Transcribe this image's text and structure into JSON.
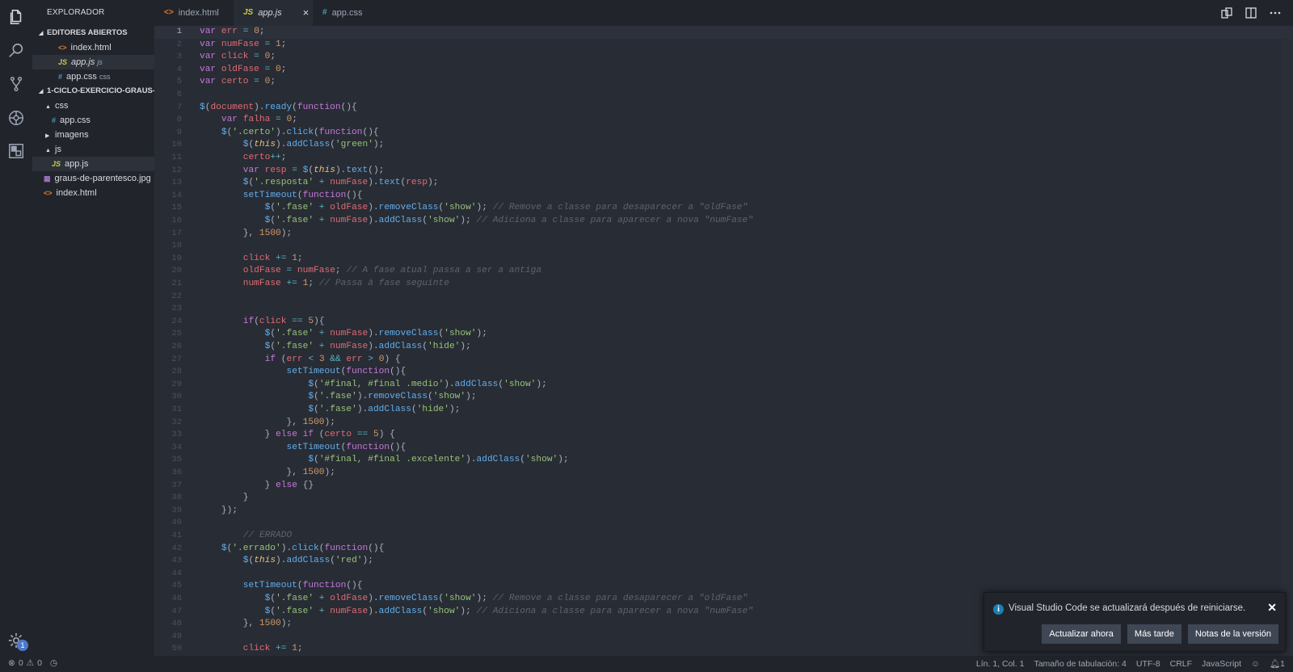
{
  "explorer": {
    "title": "EXPLORADOR",
    "open_editors_title": "EDITORES ABIERTOS",
    "open_editors": [
      {
        "icon": "<>",
        "name": "index.html",
        "sub": ""
      },
      {
        "icon": "JS",
        "name": "app.js",
        "sub": "js"
      },
      {
        "icon": "#",
        "name": "app.css",
        "sub": "css"
      }
    ],
    "project_title": "1-CICLO-EXERCICIO-GRAUS-...",
    "tree": [
      {
        "icon": "▲",
        "name": "css"
      },
      {
        "icon": "#",
        "name": "app.css"
      },
      {
        "icon": "▶",
        "name": "imagens"
      },
      {
        "icon": "▲",
        "name": "js"
      },
      {
        "icon": "JS",
        "name": "app.js"
      },
      {
        "icon": "▦",
        "name": "graus-de-parentesco.jpg"
      },
      {
        "icon": "<>",
        "name": "index.html"
      }
    ]
  },
  "tabs": [
    {
      "icon": "<>",
      "label": "index.html"
    },
    {
      "icon": "JS",
      "label": "app.js"
    },
    {
      "icon": "#",
      "label": "app.css"
    }
  ],
  "tab_close": "×",
  "activity": {
    "badge": "1"
  },
  "editor": {
    "line_numbers": [
      "1",
      "2",
      "3",
      "4",
      "5",
      "6",
      "7",
      "8",
      "9",
      "10",
      "11",
      "12",
      "13",
      "14",
      "15",
      "16",
      "17",
      "18",
      "19",
      "20",
      "21",
      "22",
      "23",
      "24",
      "25",
      "26",
      "27",
      "28",
      "29",
      "30",
      "31",
      "32",
      "33",
      "34",
      "35",
      "36",
      "37",
      "38",
      "39",
      "40",
      "41",
      "42",
      "43",
      "44",
      "45",
      "46",
      "47",
      "48",
      "49",
      "50"
    ],
    "lines": [
      "var err = 0;",
      "var numFase = 1;",
      "var click = 0;",
      "var oldFase = 0;",
      "var certo = 0;",
      "",
      "$(document).ready(function(){",
      "    var falha = 0;",
      "    $('.certo').click(function(){",
      "        $(this).addClass('green');",
      "        certo++;",
      "        var resp = $(this).text();",
      "        $('.resposta' + numFase).text(resp);",
      "        setTimeout(function(){",
      "            $('.fase' + oldFase).removeClass('show'); // Remove a classe para desaparecer a \"oldFase\"",
      "            $('.fase' + numFase).addClass('show'); // Adiciona a classe para aparecer a nova \"numFase\"",
      "        }, 1500);",
      "",
      "        click += 1;",
      "        oldFase = numFase; // A fase atual passa a ser a antiga",
      "        numFase += 1; // Passa à fase seguinte",
      "",
      "",
      "        if(click == 5){",
      "            $('.fase' + numFase).removeClass('show');",
      "            $('.fase' + numFase).addClass('hide');",
      "            if (err < 3 && err > 0) {",
      "                setTimeout(function(){",
      "                    $('#final, #final .medio').addClass('show');",
      "                    $('.fase').removeClass('show');",
      "                    $('.fase').addClass('hide');",
      "                }, 1500);",
      "            } else if (certo == 5) {",
      "                setTimeout(function(){",
      "                    $('#final, #final .excelente').addClass('show');",
      "                }, 1500);",
      "            } else {}",
      "        }",
      "    });",
      "",
      "        // ERRADO",
      "    $('.errado').click(function(){",
      "        $(this).addClass('red');",
      "",
      "        setTimeout(function(){",
      "            $('.fase' + oldFase).removeClass('show'); // Remove a classe para desaparecer a \"oldFase\"",
      "            $('.fase' + numFase).addClass('show'); // Adiciona a classe para aparecer a nova \"numFase\"",
      "        }, 1500);",
      "",
      "        click += 1;"
    ]
  },
  "status": {
    "errors": "0",
    "warnings": "0",
    "position": "Lín. 1, Col. 1",
    "tab_size": "Tamaño de tabulación: 4",
    "encoding": "UTF-8",
    "eol": "CRLF",
    "language": "JavaScript",
    "notifications": "1"
  },
  "notification": {
    "message": "Visual Studio Code se actualizará después de reiniciarse.",
    "buttons": [
      "Actualizar ahora",
      "Más tarde",
      "Notas de la versión"
    ]
  },
  "colors": {
    "editor_bg": "#282c34",
    "sidebar_bg": "#21252b",
    "keyword": "#c678dd",
    "variable": "#e06c75",
    "number": "#d19a66",
    "function": "#61afef",
    "string": "#98c379",
    "comment": "#5c6370"
  }
}
